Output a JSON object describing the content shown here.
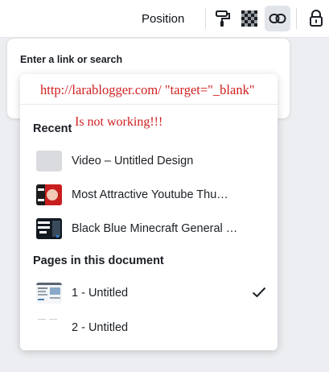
{
  "toolbar": {
    "position_label": "Position",
    "icons": [
      "paint-roller-icon",
      "transparency-icon",
      "link-icon",
      "lock-icon"
    ]
  },
  "link_panel": {
    "title": "Enter a link or search",
    "input_value": "http://larablogger.com/ \"target=\"_blank\"",
    "annotation": "Is not working!!!"
  },
  "recent": {
    "title": "Recent",
    "items": [
      {
        "label": "Video – Untitled Design"
      },
      {
        "label": "Most Attractive Youtube Thu…"
      },
      {
        "label": "Black Blue Minecraft General …"
      }
    ]
  },
  "pages": {
    "title": "Pages in this document",
    "items": [
      {
        "label": "1 - Untitled",
        "selected": true
      },
      {
        "label": "2 - Untitled",
        "selected": false
      }
    ]
  },
  "colors": {
    "annotation_red": "#d02020",
    "panel_bg": "#ffffff",
    "active_button": "#e1e4e8"
  }
}
